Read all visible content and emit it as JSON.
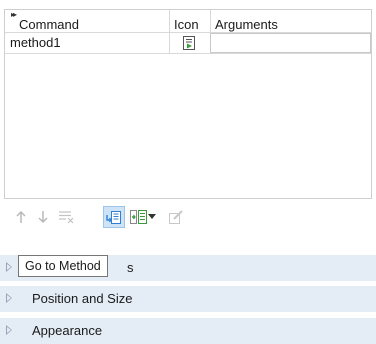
{
  "table": {
    "columns": [
      "Command",
      "Icon",
      "Arguments"
    ],
    "rows": [
      {
        "command": "method1",
        "icon": "method-icon",
        "arguments": ""
      }
    ]
  },
  "toolbar": {
    "buttons": [
      {
        "icon": "arrow-up-icon",
        "enabled": false
      },
      {
        "icon": "arrow-down-icon",
        "enabled": false
      },
      {
        "icon": "delete-list-icon",
        "enabled": false
      },
      {
        "icon": "go-to-method-icon",
        "enabled": true,
        "active": true
      },
      {
        "icon": "add-method-icon",
        "enabled": true
      },
      {
        "icon": "dropdown-arrow-icon",
        "enabled": true
      },
      {
        "icon": "edit-icon",
        "enabled": false
      }
    ]
  },
  "tooltip": {
    "text": "Go to Method"
  },
  "sections": [
    {
      "label": "s"
    },
    {
      "label": "Position and Size"
    },
    {
      "label": "Appearance"
    }
  ],
  "colors": {
    "section_bg": "#e4ecf6",
    "active_button_bg": "#cfe3f7",
    "icon_blue": "#2f7fd6",
    "icon_green": "#3a9b3a"
  }
}
